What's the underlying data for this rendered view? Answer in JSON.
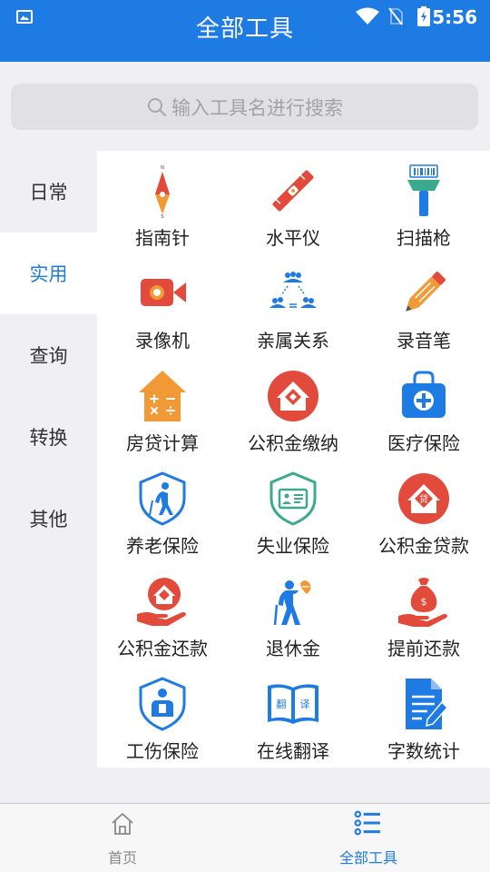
{
  "status_bar": {
    "time": "5:56"
  },
  "header": {
    "title": "全部工具"
  },
  "search": {
    "placeholder": "输入工具名进行搜索"
  },
  "colors": {
    "primary": "#1e7be4",
    "red": "#e24b3b",
    "orange": "#f09935",
    "teal": "#3aa98d"
  },
  "sidebar": {
    "items": [
      {
        "label": "日常"
      },
      {
        "label": "实用"
      },
      {
        "label": "查询"
      },
      {
        "label": "转换"
      },
      {
        "label": "其他"
      }
    ],
    "active_index": 1
  },
  "tools": [
    {
      "label": "指南针",
      "icon": "compass-icon"
    },
    {
      "label": "水平仪",
      "icon": "level-icon"
    },
    {
      "label": "扫描枪",
      "icon": "scanner-icon"
    },
    {
      "label": "录像机",
      "icon": "video-camera-icon"
    },
    {
      "label": "亲属关系",
      "icon": "relatives-icon"
    },
    {
      "label": "录音笔",
      "icon": "recorder-pen-icon"
    },
    {
      "label": "房贷计算",
      "icon": "house-calculator-icon"
    },
    {
      "label": "公积金缴纳",
      "icon": "fund-payment-icon"
    },
    {
      "label": "医疗保险",
      "icon": "medical-bag-icon"
    },
    {
      "label": "养老保险",
      "icon": "pension-shield-icon"
    },
    {
      "label": "失业保险",
      "icon": "unemployment-shield-icon"
    },
    {
      "label": "公积金贷款",
      "icon": "fund-loan-icon"
    },
    {
      "label": "公积金还款",
      "icon": "fund-repay-icon"
    },
    {
      "label": "退休金",
      "icon": "retirement-icon"
    },
    {
      "label": "提前还款",
      "icon": "money-bag-icon"
    },
    {
      "label": "工伤保险",
      "icon": "injury-shield-icon"
    },
    {
      "label": "在线翻译",
      "icon": "translate-book-icon"
    },
    {
      "label": "字数统计",
      "icon": "document-count-icon"
    }
  ],
  "tool_icon_texts": {
    "loan_char": "贷",
    "translate_left": "翻",
    "translate_right": "译"
  },
  "bottom_nav": {
    "items": [
      {
        "label": "首页",
        "icon": "home-icon",
        "active": false
      },
      {
        "label": "全部工具",
        "icon": "list-icon",
        "active": true
      }
    ]
  }
}
